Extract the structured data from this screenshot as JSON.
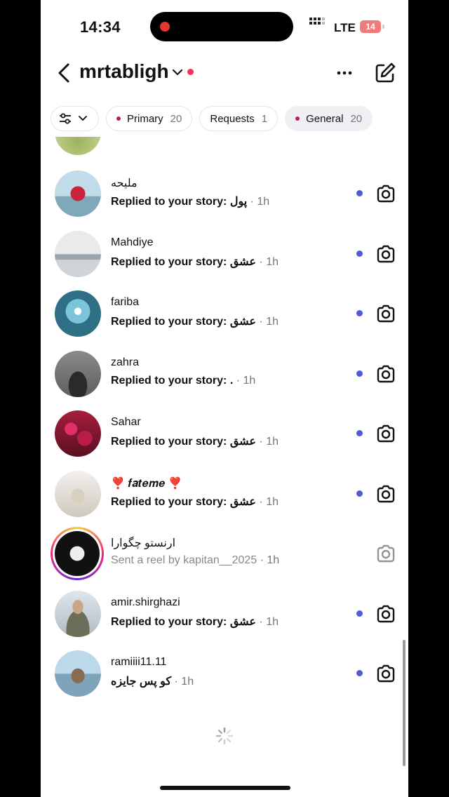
{
  "status_bar": {
    "time": "14:34",
    "network": "LTE",
    "battery": "14"
  },
  "header": {
    "account_name": "mrtabligh"
  },
  "tabs": [
    {
      "label": "Primary",
      "count": "20"
    },
    {
      "label": "Requests",
      "count": "1"
    },
    {
      "label": "General",
      "count": "20"
    }
  ],
  "threads": [
    {
      "name": "ملیحه",
      "prefix": "Replied to your story:",
      "message": "پول",
      "time": "· 1h",
      "unread": true
    },
    {
      "name": "Mahdiye",
      "prefix": "Replied to your story:",
      "message": "عشق",
      "time": "· 1h",
      "unread": true
    },
    {
      "name": "fariba",
      "prefix": "Replied to your story:",
      "message": "عشق",
      "time": "· 1h",
      "unread": true
    },
    {
      "name": "zahra",
      "prefix": "Replied to your story:",
      "message": ".",
      "time": "· 1h",
      "unread": true
    },
    {
      "name": "Sahar",
      "prefix": "Replied to your story:",
      "message": "عشق",
      "time": "· 1h",
      "unread": true
    },
    {
      "name": "❣️ 𝒇𝒂𝒕𝒆𝒎𝒆 ❣️",
      "prefix": "Replied to your story:",
      "message": "عشق",
      "time": "· 1h",
      "unread": true
    },
    {
      "name": "ارنستو چگوارا",
      "prefix": "Sent a reel by kapitan__2025",
      "message": "",
      "time": "· 1h",
      "unread": false
    },
    {
      "name": "amir.shirghazi",
      "prefix": "Replied to your story:",
      "message": "عشق",
      "time": "· 1h",
      "unread": true
    },
    {
      "name": "ramiiii11.11",
      "prefix": "",
      "message": "کو پس جایزه",
      "time": "· 1h",
      "unread": true
    }
  ],
  "colors": {
    "unread_dot": "#4f5bd5",
    "tab_dot": "#c2185b",
    "account_dot": "#ff2d55"
  }
}
